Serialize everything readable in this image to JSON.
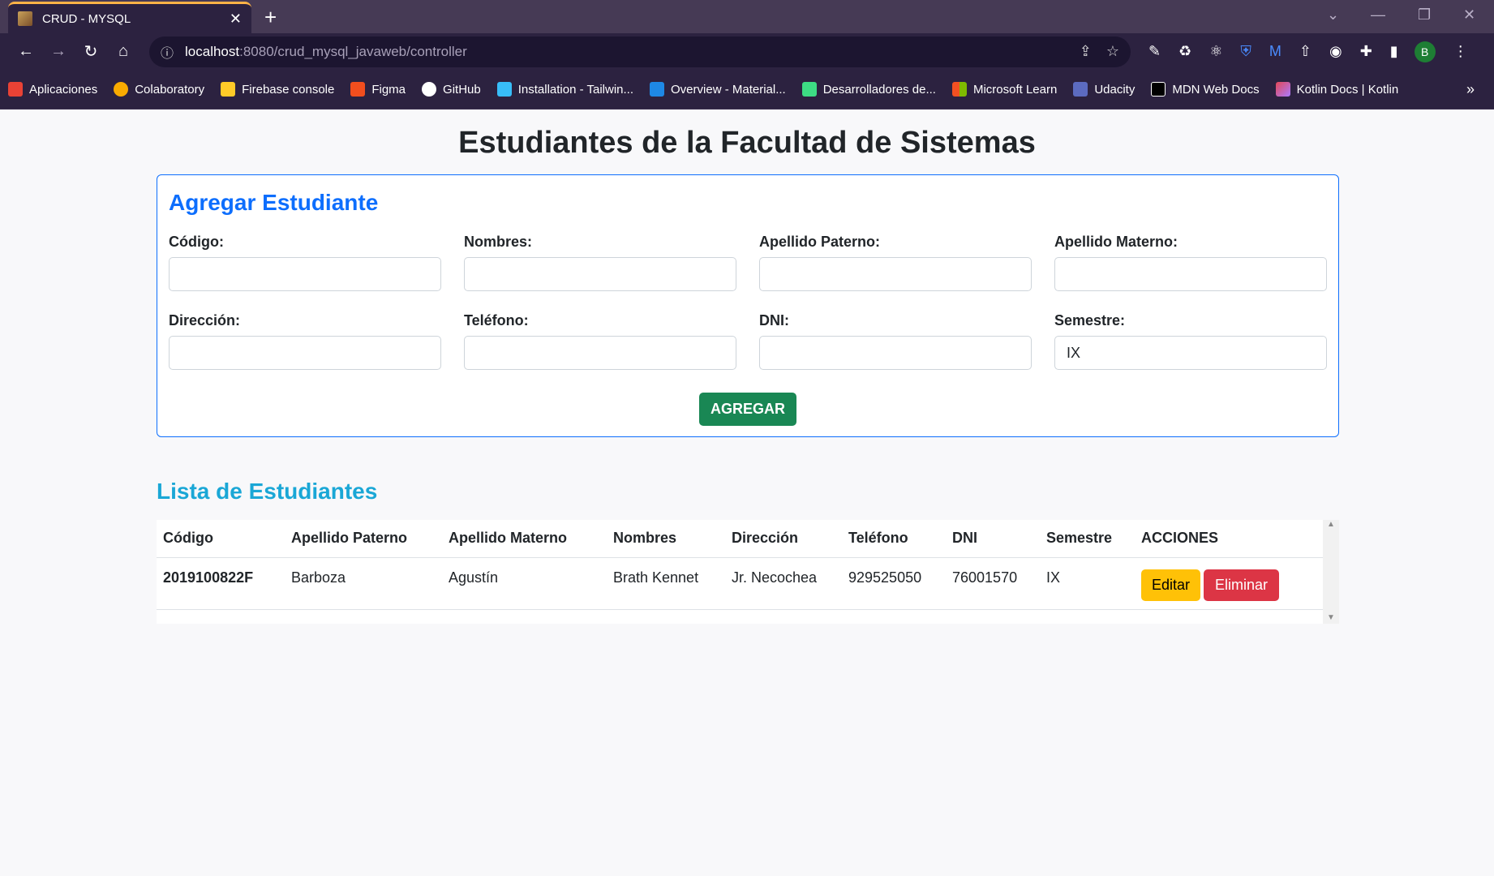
{
  "browser": {
    "tab_title": "CRUD - MYSQL",
    "url_host": "localhost",
    "url_path": ":8080/crud_mysql_javaweb/controller",
    "avatar_letter": "B",
    "bookmarks": [
      {
        "label": "Aplicaciones",
        "icon": "apps-grid-icon",
        "color": "#e94235"
      },
      {
        "label": "Colaboratory",
        "icon": "colab-icon",
        "color": "#f9ab00"
      },
      {
        "label": "Firebase console",
        "icon": "firebase-icon",
        "color": "#ffca28"
      },
      {
        "label": "Figma",
        "icon": "figma-icon",
        "color": "#f24e1e"
      },
      {
        "label": "GitHub",
        "icon": "github-icon",
        "color": "#ffffff"
      },
      {
        "label": "Installation - Tailwin...",
        "icon": "tailwind-icon",
        "color": "#38bdf8"
      },
      {
        "label": "Overview - Material...",
        "icon": "material-icon",
        "color": "#1e88e5"
      },
      {
        "label": "Desarrolladores de...",
        "icon": "android-icon",
        "color": "#3ddc84"
      },
      {
        "label": "Microsoft Learn",
        "icon": "microsoft-icon",
        "color": "#f25022"
      },
      {
        "label": "Udacity",
        "icon": "udacity-icon",
        "color": "#5c6bc0"
      },
      {
        "label": "MDN Web Docs",
        "icon": "mdn-icon",
        "color": "#ffffff"
      },
      {
        "label": "Kotlin Docs | Kotlin",
        "icon": "kotlin-icon",
        "color": "#a97bff"
      }
    ]
  },
  "page": {
    "title": "Estudiantes de la Facultad de Sistemas"
  },
  "form": {
    "title": "Agregar Estudiante",
    "fields": [
      {
        "label": "Código:",
        "value": ""
      },
      {
        "label": "Nombres:",
        "value": ""
      },
      {
        "label": "Apellido Paterno:",
        "value": ""
      },
      {
        "label": "Apellido Materno:",
        "value": ""
      },
      {
        "label": "Dirección:",
        "value": ""
      },
      {
        "label": "Teléfono:",
        "value": ""
      },
      {
        "label": "DNI:",
        "value": ""
      },
      {
        "label": "Semestre:",
        "value": "IX"
      }
    ],
    "submit_label": "AGREGAR"
  },
  "list": {
    "title": "Lista de Estudiantes",
    "columns": [
      "Código",
      "Apellido Paterno",
      "Apellido Materno",
      "Nombres",
      "Dirección",
      "Teléfono",
      "DNI",
      "Semestre",
      "ACCIONES"
    ],
    "rows": [
      {
        "codigo": "2019100822F",
        "apellido_paterno": "Barboza",
        "apellido_materno": "Agustín",
        "nombres": "Brath Kennet",
        "direccion": "Jr. Necochea",
        "telefono": "929525050",
        "dni": "76001570",
        "semestre": "IX",
        "edit_label": "Editar",
        "delete_label": "Eliminar"
      }
    ]
  },
  "colors": {
    "primary": "#0d6efd",
    "success": "#198754",
    "warning": "#ffc107",
    "danger": "#dc3545",
    "info": "#1aa7d6"
  }
}
